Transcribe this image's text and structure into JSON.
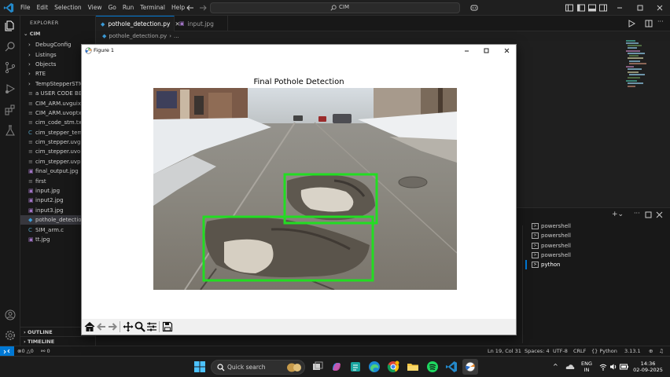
{
  "window": {
    "menu": [
      "File",
      "Edit",
      "Selection",
      "View",
      "Go",
      "Run",
      "Terminal",
      "Help"
    ],
    "command_center_text": "CIM"
  },
  "explorer": {
    "header": "EXPLORER",
    "root": "CIM",
    "items": [
      {
        "label": "DebugConfig",
        "kind": "folder"
      },
      {
        "label": "Listings",
        "kind": "folder"
      },
      {
        "label": "Objects",
        "kind": "folder"
      },
      {
        "label": "RTE",
        "kind": "folder"
      },
      {
        "label": "TempStepperSTM",
        "kind": "folder"
      },
      {
        "label": "a USER CODE BEG",
        "kind": "file"
      },
      {
        "label": "CIM_ARM.uvguix",
        "kind": "file"
      },
      {
        "label": "CIM_ARM.uvoptx",
        "kind": "file"
      },
      {
        "label": "cim_code_stm.txt",
        "kind": "file"
      },
      {
        "label": "cim_stepper_temp",
        "kind": "c"
      },
      {
        "label": "cim_stepper.uvgui",
        "kind": "file"
      },
      {
        "label": "cim_stepper.uvopt",
        "kind": "file"
      },
      {
        "label": "cim_stepper.uvpro",
        "kind": "file"
      },
      {
        "label": "final_output.jpg",
        "kind": "image"
      },
      {
        "label": "first",
        "kind": "file"
      },
      {
        "label": "input.jpg",
        "kind": "image"
      },
      {
        "label": "input2.jpg",
        "kind": "image"
      },
      {
        "label": "input3.jpg",
        "kind": "image"
      },
      {
        "label": "pothole_detection",
        "kind": "python"
      },
      {
        "label": "SIM_arm.c",
        "kind": "c"
      },
      {
        "label": "tt.jpg",
        "kind": "image"
      }
    ],
    "outline": "OUTLINE",
    "timeline": "TIMELINE"
  },
  "tabs": [
    {
      "label": "pothole_detection.py"
    },
    {
      "label": "input.jpg"
    }
  ],
  "breadcrumb": {
    "file": "pothole_detection.py",
    "more": "..."
  },
  "terminal_list": [
    {
      "label": "powershell"
    },
    {
      "label": "powershell"
    },
    {
      "label": "powershell"
    },
    {
      "label": "powershell"
    },
    {
      "label": "python"
    }
  ],
  "statusbar": {
    "errors": "0",
    "warnings": "0",
    "ports": "0",
    "position": "Ln 19, Col 31",
    "spaces": "Spaces: 4",
    "encoding": "UTF-8",
    "eol": "CRLF",
    "language": "Python",
    "version": "3.13.1"
  },
  "figure": {
    "window_title": "Figure 1",
    "plot_title": "Final Pothole Detection",
    "detections_shown": 2,
    "box_color": "#22dd22"
  },
  "taskbar": {
    "search_placeholder": "Quick search",
    "lang": "ENG",
    "region": "IN",
    "time": "14:36",
    "date": "02-09-2025"
  },
  "colors": {
    "accent": "#0078d4",
    "editor_bg": "#1f1f1f",
    "sidebar_bg": "#181818"
  }
}
